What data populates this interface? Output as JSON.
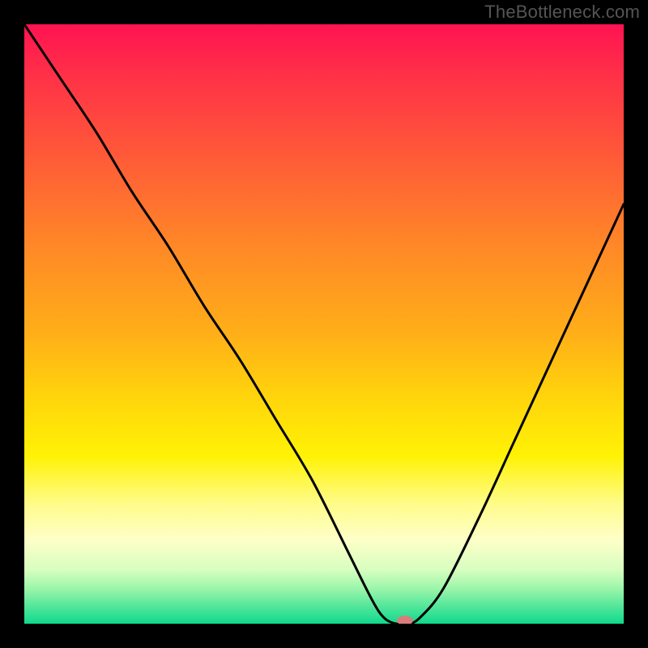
{
  "watermark": "TheBottleneck.com",
  "marker": {
    "x_pct": 63.5,
    "color": "#d87d7d",
    "rx": 10,
    "ry": 6
  },
  "chart_data": {
    "type": "line",
    "title": "",
    "xlabel": "",
    "ylabel": "",
    "xlim": [
      0,
      100
    ],
    "ylim": [
      0,
      100
    ],
    "grid": false,
    "legend": false,
    "series": [
      {
        "name": "bottleneck-curve",
        "x": [
          0,
          6,
          12,
          18,
          24,
          30,
          36,
          42,
          48,
          54,
          58,
          60,
          62,
          64,
          66,
          70,
          76,
          82,
          88,
          94,
          100
        ],
        "y": [
          100,
          91,
          82,
          72,
          63,
          53,
          44,
          34,
          24,
          12,
          4,
          1,
          0,
          0,
          1,
          6,
          18,
          31,
          44,
          57,
          70
        ]
      }
    ],
    "note": "y is bottleneck percentage (0 at bottom, 100 at top). x is relative hardware scale 0–100. Minimum plateau ≈ x 61–65."
  }
}
